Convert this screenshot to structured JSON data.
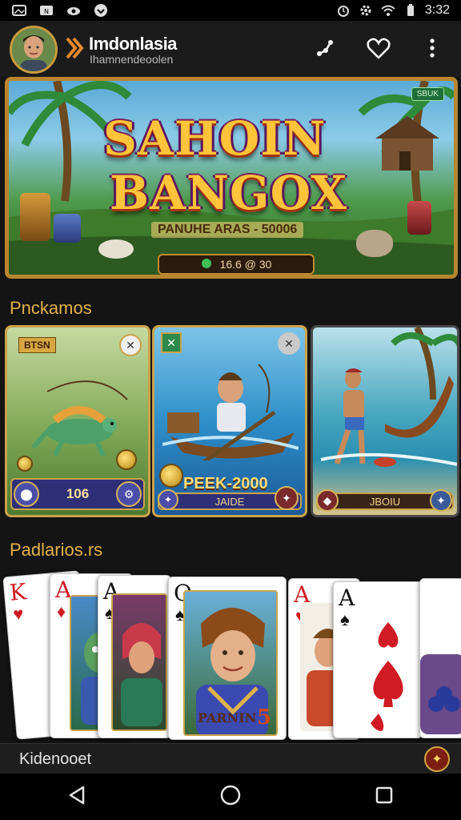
{
  "status_bar": {
    "time": "3:32",
    "left_icons": [
      "gallery-icon",
      "nfc-icon",
      "cloud-icon",
      "download-icon"
    ],
    "right_icons": [
      "alarm-icon",
      "settings-icon",
      "wifi-icon",
      "battery-icon"
    ]
  },
  "header": {
    "title": "Imdonlasia",
    "subtitle": "Ihamnendeoolen",
    "actions": [
      "share-icon",
      "heart-icon",
      "more-vert-icon"
    ]
  },
  "banner": {
    "badge": "SBUK",
    "title_line1": "SAHOIN",
    "title_line2": "BANGOX",
    "subtitle": "PANUHE ARAS - 50006",
    "pill_text": "16.6 @ 30"
  },
  "sections": {
    "first": "Pnckamos",
    "second": "Padlarios.rs"
  },
  "game_cards": [
    {
      "tag": "BTSN",
      "footer": "106",
      "theme": "fishing-lizard"
    },
    {
      "tag": "",
      "footer": "PEEK-2000",
      "sub": "JAIDE",
      "theme": "boat-man"
    },
    {
      "tag": "",
      "footer": "JBOIU",
      "theme": "shore-fisherman"
    }
  ],
  "playing_cards": [
    {
      "rank": "K",
      "suit": "♥",
      "color": "red"
    },
    {
      "rank": "A",
      "suit": "♦",
      "color": "red"
    },
    {
      "rank": "A",
      "suit": "♠",
      "color": "black"
    },
    {
      "rank": "Q",
      "suit": "♠",
      "color": "black"
    },
    {
      "rank": "A",
      "suit": "♥",
      "color": "red"
    },
    {
      "rank": "A",
      "suit": "♠",
      "color": "black"
    }
  ],
  "hero_card_caption": "PARNIN",
  "hero_card_number": "5",
  "info_bar": {
    "text": "Kidenooet"
  },
  "colors": {
    "accent_gold": "#c9a24a",
    "heading_gold": "#e3b24a",
    "background": "#141414"
  }
}
